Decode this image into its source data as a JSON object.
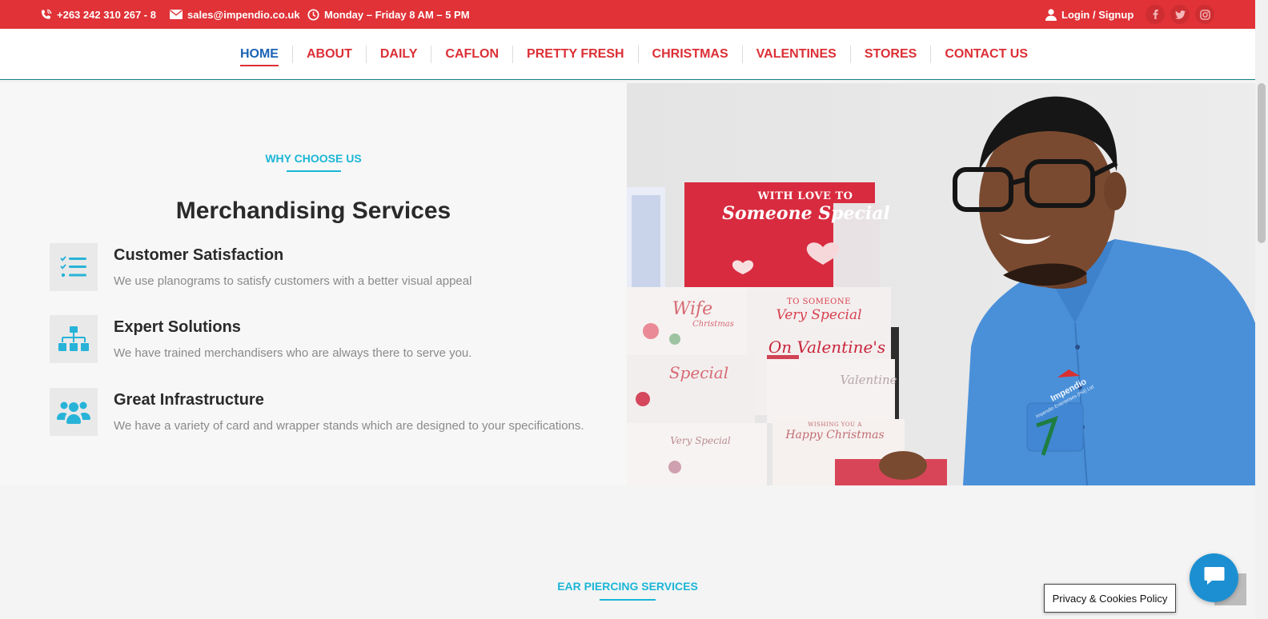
{
  "topbar": {
    "phone": "+263 242 310 267 - 8",
    "email": "sales@impendio.co.uk",
    "hours": "Monday – Friday 8 AM – 5 PM",
    "login": "Login / Signup",
    "social": [
      "facebook-icon",
      "twitter-icon",
      "instagram-icon"
    ]
  },
  "nav": {
    "items": [
      "HOME",
      "ABOUT",
      "DAILY",
      "CAFLON",
      "PRETTY FRESH",
      "CHRISTMAS",
      "VALENTINES",
      "STORES",
      "CONTACT US"
    ],
    "active": "HOME"
  },
  "section": {
    "kicker": "WHY CHOOSE US",
    "heading": "Merchandising Services",
    "features": [
      {
        "icon": "checklist-icon",
        "title": "Customer Satisfaction",
        "desc": "We use planograms to satisfy customers with a better visual appeal"
      },
      {
        "icon": "org-chart-icon",
        "title": "Expert Solutions",
        "desc": "We have trained merchandisers who are always there to serve you."
      },
      {
        "icon": "users-icon",
        "title": "Great Infrastructure",
        "desc": "We have a variety of card and wrapper stands which are designed to your specifications."
      }
    ]
  },
  "photo": {
    "card_texts": [
      "WITH LOVE TO",
      "Someone Special",
      "TO SOMEONE",
      "Very Special",
      "On Valentine's",
      "Valentine",
      "Wife",
      "Christmas",
      "Special",
      "WISHING YOU A",
      "Happy Christmas",
      "Very Special"
    ],
    "shirt_logo": "Impendio",
    "shirt_logo_sub": "Impendio Enterprises (Pvt) Ltd"
  },
  "lower": {
    "kicker": "EAR PIERCING SERVICES"
  },
  "privacy": "Privacy & Cookies Policy",
  "colors": {
    "brand_red": "#e03237",
    "nav_red": "#dc2f36",
    "active_blue": "#1a63b5",
    "accent_cyan": "#1bb6d6",
    "chat_blue": "#1b8fd1"
  }
}
